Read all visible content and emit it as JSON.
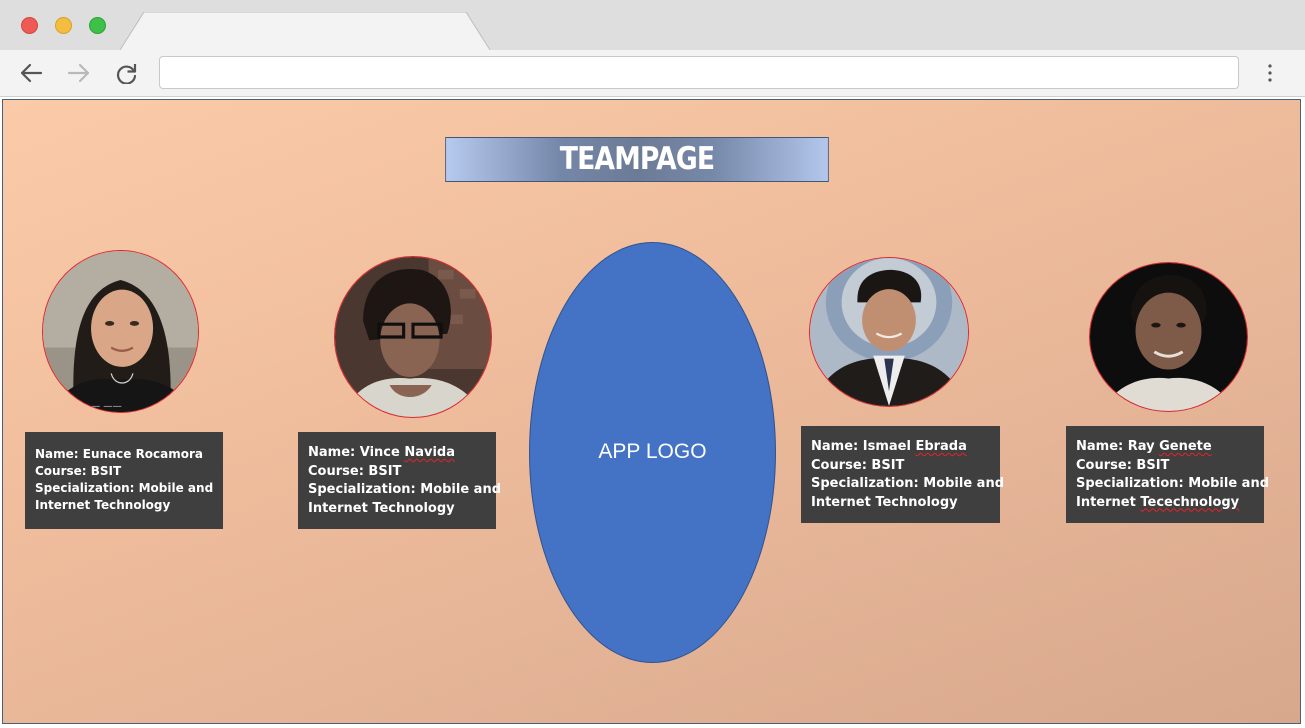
{
  "browser": {
    "url": "",
    "icons": [
      "back-arrow-icon",
      "forward-arrow-icon",
      "reload-icon",
      "more-vertical-icon"
    ]
  },
  "page": {
    "title": "TEAMPAGE",
    "logo_label": "APP LOGO",
    "colors": {
      "background_start": "#fbcba9",
      "background_end": "#d8a88c",
      "logo_fill": "#4472c4",
      "card_bg": "#3f3f3f",
      "avatar_border": "#e3232b"
    },
    "members": [
      {
        "name_line": "Name: Eunace Rocamora",
        "course_line": "Course: BSIT",
        "spec_line1": "Specialization: Mobile and",
        "spec_line2": "Internet Technology"
      },
      {
        "name_prefix": "Name: Vince ",
        "name_flagged": "Navida",
        "course_line": "Course: BSIT",
        "spec_line1": "Specialization: Mobile and",
        "spec_line2": "Internet Technology"
      },
      {
        "name_prefix": "Name: Ismael ",
        "name_flagged": "Ebrada",
        "course_line": "Course: BSIT",
        "spec_line1": "Specialization: Mobile and",
        "spec_line2": "Internet Technology"
      },
      {
        "name_prefix": "Name: Ray ",
        "name_flagged": "Genete",
        "course_line": "Course: BSIT",
        "spec_line1": "Specialization: Mobile and",
        "spec_line2_flagged": "Tecechnology",
        "spec_line2_prefix": "Internet "
      }
    ]
  }
}
